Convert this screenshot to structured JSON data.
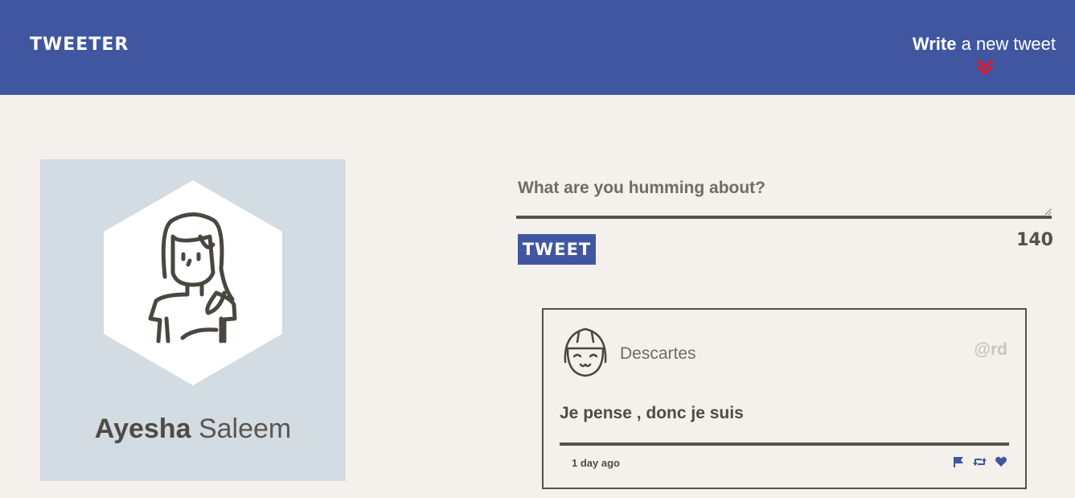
{
  "nav": {
    "brand": "TWEETER",
    "write_bold": "Write",
    "write_rest": "a new tweet",
    "chevron_icon": "double-chevron-down-icon",
    "chevron_color": "#e0162b"
  },
  "colors": {
    "nav_bg": "#4056a1",
    "page_bg": "#f4f1ec",
    "profile_bg": "#d3dbe3",
    "text": "#4e4a45",
    "accent": "#4056a1"
  },
  "profile": {
    "first_name": "Ayesha",
    "last_name": "Saleem",
    "avatar_icon": "woman-avatar-icon"
  },
  "compose": {
    "placeholder": "What are you humming about?",
    "value": "",
    "button_label": "TWEET",
    "counter": "140"
  },
  "tweets": [
    {
      "avatar_icon": "smiling-face-avatar-icon",
      "author": "Descartes",
      "handle": "@rd",
      "content": "Je pense , donc je suis",
      "age": "1 day ago",
      "actions": [
        "flag-icon",
        "retweet-icon",
        "heart-icon"
      ]
    }
  ]
}
